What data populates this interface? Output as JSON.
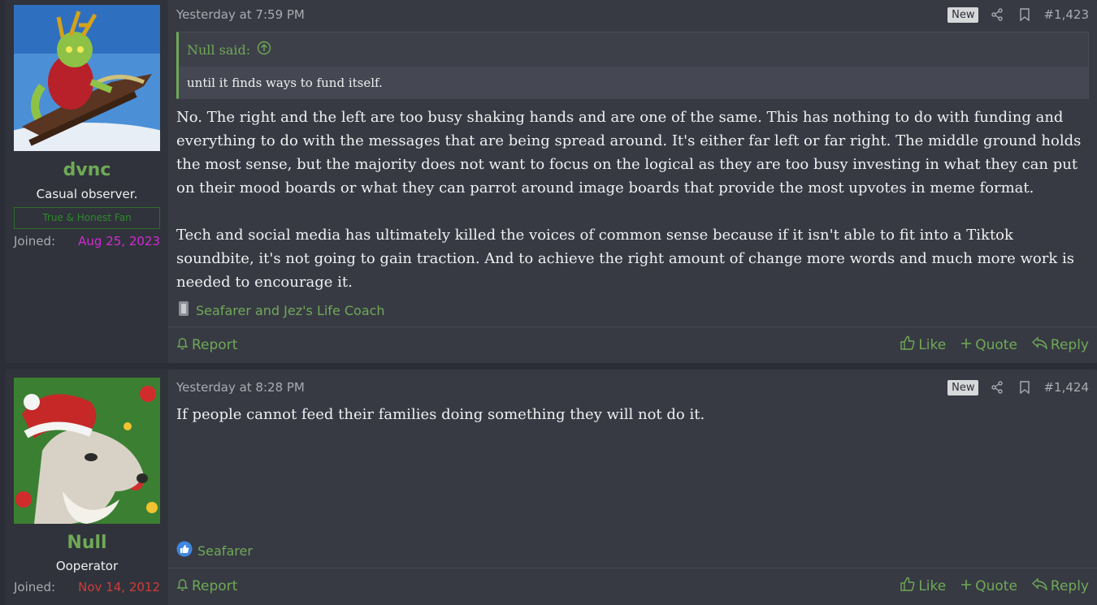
{
  "posts": [
    {
      "user": {
        "name": "dvnc",
        "title": "Casual observer.",
        "banner": "True & Honest Fan",
        "joined_label": "Joined:",
        "joined_date": "Aug 25, 2023",
        "avatar_icon": "grinch-sleigh-avatar"
      },
      "time": "Yesterday at 7:59 PM",
      "badge": "New",
      "number": "#1,423",
      "quote": {
        "author": "Null said:",
        "text": "until it finds ways to fund itself."
      },
      "paragraphs": [
        "No. The right and the left are too busy shaking hands and are one of the same. This has nothing to do with funding and everything to do with the messages that are being spread around. It's either far left or far right. The middle ground holds the most sense, but the majority does not want to focus on the logical as they are too busy investing in what they can put on their mood boards or what they can parrot around image boards that provide the most upvotes in meme format.",
        "Tech and social media has ultimately killed the voices of common sense because if it isn't able to fit into a Tiktok soundbite, it's not going to gain traction. And to achieve the right amount of change more words and much more work is needed to encourage it."
      ],
      "reactions": "Seafarer and Jez's Life Coach",
      "actions": {
        "report": "Report",
        "like": "Like",
        "quote": "Quote",
        "reply": "Reply"
      }
    },
    {
      "user": {
        "name": "Null",
        "title": "Ooperator",
        "joined_label": "Joined:",
        "joined_date": "Nov 14, 2012",
        "avatar_icon": "santa-dog-avatar"
      },
      "time": "Yesterday at 8:28 PM",
      "badge": "New",
      "number": "#1,424",
      "paragraphs": [
        "If people cannot feed their families doing something they will not do it."
      ],
      "reactions": "Seafarer",
      "actions": {
        "report": "Report",
        "like": "Like",
        "quote": "Quote",
        "reply": "Reply"
      }
    }
  ],
  "colors": {
    "accent": "#6fa956",
    "background": "#2b2e36",
    "post_bg": "#373a43",
    "joined_date_1": "#d12bd1",
    "joined_date_2": "#d03c3c"
  }
}
